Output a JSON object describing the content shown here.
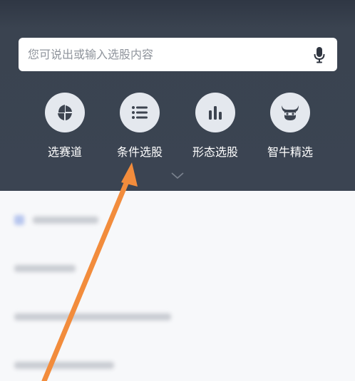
{
  "search": {
    "placeholder": "您可说出或输入选股内容"
  },
  "quick_actions": [
    {
      "label": "选赛道",
      "icon": "track-icon"
    },
    {
      "label": "条件选股",
      "icon": "list-icon"
    },
    {
      "label": "形态选股",
      "icon": "bar-chart-icon"
    },
    {
      "label": "智牛精选",
      "icon": "bull-icon"
    }
  ],
  "colors": {
    "header_bg": "#3b4452",
    "icon_circle": "#e4e8ee",
    "icon_glyph": "#3d4450",
    "annotation_arrow": "#f28c3c"
  }
}
